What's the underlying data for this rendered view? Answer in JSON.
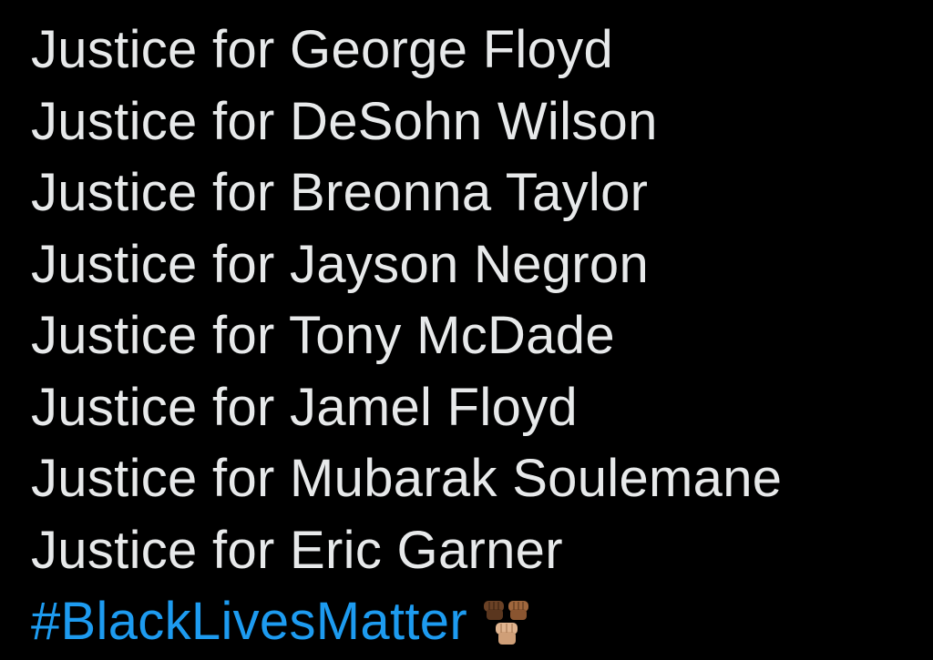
{
  "post": {
    "lines": [
      "Justice for George Floyd",
      "Justice for DeSohn Wilson",
      "Justice for Breonna Taylor",
      "Justice for Jayson Negron",
      "Justice for Tony McDade",
      "Justice for Jamel Floyd",
      "Justice for Mubarak Soulemane",
      "Justice for Eric Garner"
    ],
    "hashtag": "#BlackLivesMatter",
    "emoji": "raised-fists-emoji"
  },
  "colors": {
    "background": "#000000",
    "text": "#e7e9ea",
    "hashtag": "#1d9bf0",
    "fist_dark": "#6b4226",
    "fist_medium": "#a0673d",
    "fist_light": "#e0b48f"
  }
}
